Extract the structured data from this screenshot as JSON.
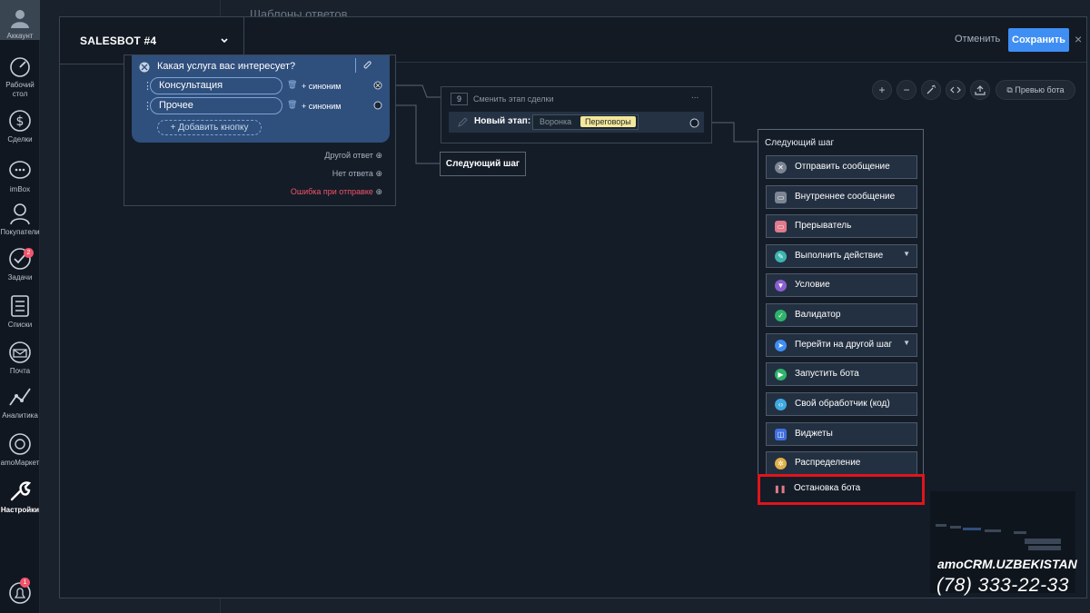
{
  "rail": {
    "items": [
      {
        "label": "Аккаунт",
        "icon": "account-avatar-icon"
      },
      {
        "label": "Рабочий стол",
        "icon": "dashboard-icon"
      },
      {
        "label": "Сделки",
        "icon": "deals-icon"
      },
      {
        "label": "imBox",
        "icon": "chat-icon"
      },
      {
        "label": "Покупатели",
        "icon": "customers-icon"
      },
      {
        "label": "Задачи",
        "icon": "tasks-icon",
        "badge": "2"
      },
      {
        "label": "Списки",
        "icon": "lists-icon"
      },
      {
        "label": "Почта",
        "icon": "mail-icon"
      },
      {
        "label": "Аналитика",
        "icon": "analytics-icon"
      },
      {
        "label": "amoМаркет",
        "icon": "market-icon"
      },
      {
        "label": "Настройки",
        "icon": "settings-icon"
      }
    ],
    "notifications_badge": "1"
  },
  "background": {
    "title": "Шаблоны ответов"
  },
  "modal": {
    "bot_name": "SALESBOT #4",
    "cancel_label": "Отменить",
    "save_label": "Сохранить",
    "close_label": "×"
  },
  "toolbar": {
    "zoom_in": "+",
    "zoom_out": "−",
    "preview_label": "Превью бота"
  },
  "question_block": {
    "title": "Какая услуга вас интересует?",
    "buttons": [
      {
        "label": "Консультация",
        "synonym": "+ синоним"
      },
      {
        "label": "Прочее",
        "synonym": "+ синоним"
      }
    ],
    "add_button_label": "+ Добавить кнопку",
    "alt_outputs": [
      "Другой ответ",
      "Нет ответа",
      "Ошибка при отправке"
    ]
  },
  "stage_block": {
    "number": "9",
    "title": "Сменить этап сделки",
    "menu": "...",
    "new_stage_label": "Новый этап:",
    "pipeline": "Воронка",
    "status": "Переговоры"
  },
  "next_step_small": {
    "label": "Следующий шаг"
  },
  "step_menu": {
    "title": "Следующий шаг",
    "items": [
      {
        "label": "Отправить сообщение",
        "icon": "send-message-icon",
        "color": "#7b8594"
      },
      {
        "label": "Внутреннее сообщение",
        "icon": "internal-message-icon",
        "color": "#7b8594"
      },
      {
        "label": "Прерыватель",
        "icon": "interrupter-icon",
        "color": "#e07a8c"
      },
      {
        "label": "Выполнить действие",
        "icon": "action-icon",
        "color": "#3bb5b0",
        "dropdown": true
      },
      {
        "label": "Условие",
        "icon": "condition-icon",
        "color": "#8b5fd0"
      },
      {
        "label": "Валидатор",
        "icon": "validator-icon",
        "color": "#2fb36b"
      },
      {
        "label": "Перейти на другой шаг",
        "icon": "goto-step-icon",
        "color": "#3f8ef3",
        "dropdown": true
      },
      {
        "label": "Запустить бота",
        "icon": "run-bot-icon",
        "color": "#2fb36b"
      },
      {
        "label": "Свой обработчик (код)",
        "icon": "code-handler-icon",
        "color": "#3fa8e0"
      },
      {
        "label": "Виджеты",
        "icon": "widgets-icon",
        "color": "#3f6fe0"
      },
      {
        "label": "Распределение",
        "icon": "distribution-icon",
        "color": "#e0b04a"
      },
      {
        "label": "Остановка бота",
        "icon": "stop-bot-icon",
        "color": "#e07a8c"
      }
    ]
  },
  "watermark": {
    "brand": "amoCRM.UZBEKISTAN",
    "phone": "(78) 333-22-33"
  }
}
